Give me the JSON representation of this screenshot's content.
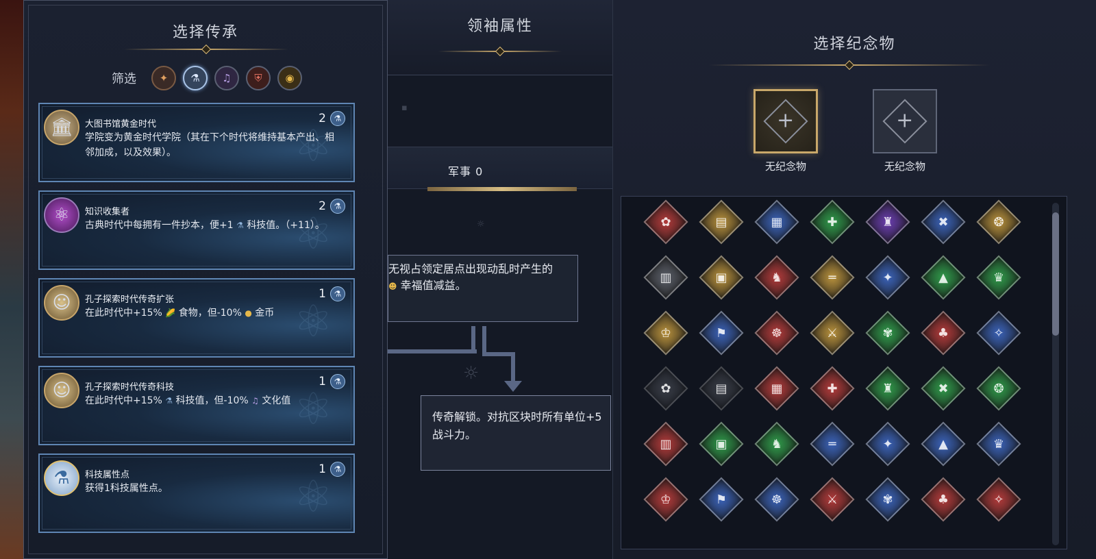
{
  "left_panel": {
    "title": "选择传承",
    "filter_label": "筛选",
    "filters": [
      {
        "icon": "multi-category-icon",
        "color": "#c08a5a"
      },
      {
        "icon": "science-flask-icon",
        "color": "#8fb3da"
      },
      {
        "icon": "culture-music-icon",
        "color": "#8b6fb8"
      },
      {
        "icon": "military-shield-icon",
        "color": "#b24a3a"
      },
      {
        "icon": "economic-coin-icon",
        "color": "#c89a3a"
      }
    ],
    "cards": [
      {
        "title": "大图书馆黄金时代",
        "cost": "2",
        "desc": "学院变为黄金时代学院（其在下个时代将维持基本产出、相邻加成，以及效果）。"
      },
      {
        "title": "知识收集者",
        "cost": "2",
        "desc_a": "古典时代中每拥有一件抄本，便+1",
        "desc_b": "科技值。（+11）。"
      },
      {
        "title": "孔子探索时代传奇扩张",
        "cost": "1",
        "desc_a": "在此时代中+15%",
        "desc_b": "食物，但-10%",
        "desc_c": "金币"
      },
      {
        "title": "孔子探索时代传奇科技",
        "cost": "1",
        "desc_a": "在此时代中+15%",
        "desc_b": "科技值，但-10%",
        "desc_c": "文化值"
      },
      {
        "title": "科技属性点",
        "cost": "1",
        "desc": "获得1科技属性点。"
      }
    ]
  },
  "middle_panel": {
    "title": "领袖属性",
    "military_label": "军事 0",
    "tooltip_top_line1": "无视占领定居点出现动乱时产生的",
    "tooltip_top_line2": "幸福值减益。",
    "tooltip_main": "传奇解锁。对抗区块时所有单位+5战斗力。"
  },
  "right_panel": {
    "title": "选择纪念物",
    "slot1_label": "无纪念物",
    "slot2_label": "无纪念物"
  },
  "colors": {
    "accent_gold": "#c9a86a",
    "card_border": "#5f86b4",
    "memento_red": "#b23a3a",
    "memento_gold": "#b8913c",
    "memento_blue": "#3a62b8",
    "memento_green": "#2f9a4a",
    "memento_purple": "#6a3db0",
    "memento_gray": "#5a5e68"
  }
}
